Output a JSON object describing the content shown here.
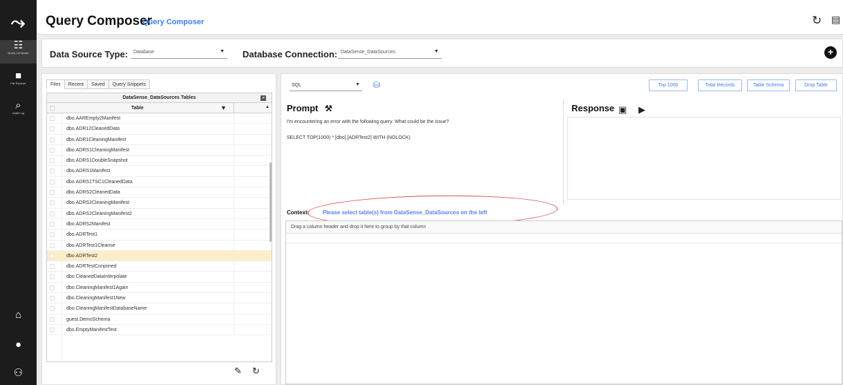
{
  "rail": {
    "items": [
      {
        "label": "Query Composer",
        "icon": "query-icon"
      },
      {
        "label": "File Explorer",
        "icon": "folder-icon"
      },
      {
        "label": "Audit Log",
        "icon": "search-icon"
      }
    ],
    "bottom": [
      "home-icon",
      "help-icon",
      "users-icon"
    ]
  },
  "header": {
    "title": "Query Composer",
    "subtitle": "Query Composer"
  },
  "datasource": {
    "type_label": "Data Source Type:",
    "type_value": "Database",
    "conn_label": "Database Connection:",
    "conn_value": "DataSense_DataSources"
  },
  "left": {
    "tabs": [
      "Files",
      "Recent",
      "Saved",
      "Query Snippets"
    ],
    "grid_title": "DataSense_DataSources Tables",
    "column": "Table",
    "rows": [
      "dbo.AAREmpty2Manifest",
      "dbo.ADR12CleanedData",
      "dbo.ADR1CleaningManifest",
      "dbo.ADRS1CleaningManifest",
      "dbo.ADRS1DoubleSnapshot",
      "dbo.ADRS1Manifest",
      "dbo.ADRS1TSC1CleanedData",
      "dbo.ADRS2CleanedData",
      "dbo.ADRS2CleaningManifest",
      "dbo.ADRS2CleaningManifest2",
      "dbo.ADRS2Manifest",
      "dbo.ADRTest1",
      "dbo.ADRTest1Cleanse",
      "dbo.ADRTest2",
      "dbo.ADRTestConjoined",
      "dbo.CleanedDataInterpolate",
      "dbo.CleaningManifest1Again",
      "dbo.CleaningManifest1New",
      "dbo.CleaningManifestDatabaseName",
      "guest.DemoSchema",
      "dbo.EmptyManifestTest"
    ],
    "selected_index": 13
  },
  "right": {
    "language": "SQL",
    "buttons": [
      "Top 1000",
      "Total Records",
      "Table Schema",
      "Drop Table"
    ],
    "prompt_title": "Prompt",
    "prompt_line1": "I'm encountering an error with the following query. What could be the issue?",
    "prompt_line2": "SELECT TOP(1000) * [dbo].[ADRTest2] WITH (NOLOCK)",
    "response_title": "Response",
    "context_label": "Context:",
    "context_msg": "Please select table(s) from DataSense_DataSources on the left",
    "drag_hint": "Drag a column header and drop it here to group by that column"
  }
}
